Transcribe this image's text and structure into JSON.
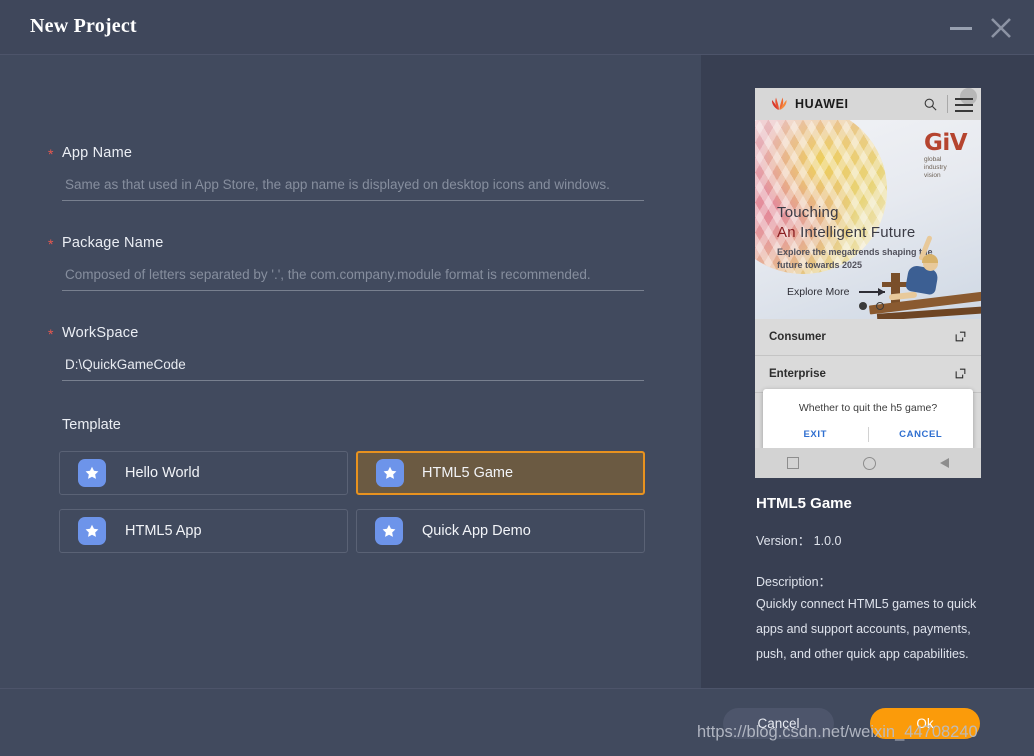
{
  "window": {
    "title": "New Project",
    "minimize_icon": "minimize-icon",
    "close_icon": "close-icon"
  },
  "form": {
    "fields": [
      {
        "label": "App Name",
        "required": "*",
        "value": "",
        "placeholder": "Same as that used in App Store, the app name is displayed on desktop icons and windows."
      },
      {
        "label": "Package Name",
        "required": "*",
        "value": "",
        "placeholder": "Composed of letters separated by '.', the com.company.module format is recommended."
      },
      {
        "label": "WorkSpace",
        "required": "*",
        "value": "D:\\QuickGameCode",
        "placeholder": ""
      }
    ],
    "template_label": "Template",
    "templates": [
      {
        "name": "Hello World",
        "icon": "star-icon",
        "selected": false
      },
      {
        "name": "HTML5 Game",
        "icon": "star-icon",
        "selected": true
      },
      {
        "name": "HTML5 App",
        "icon": "star-icon",
        "selected": false
      },
      {
        "name": "Quick App Demo",
        "icon": "star-icon",
        "selected": false
      }
    ]
  },
  "preview": {
    "phone": {
      "brand": "HUAWEI",
      "search_icon": "search-icon",
      "menu_icon": "hamburger-menu-icon",
      "banner": {
        "logo_mark": "GiV",
        "logo_sub": "global\nindustry\nvision",
        "line1": "Touching",
        "line2_accent": "An",
        "line2_rest": " Intelligent Future",
        "subtitle": "Explore the megatrends shaping the future towards 2025",
        "cta": "Explore More",
        "cta_icon": "arrow-right-icon",
        "carousel_dots": 2,
        "carousel_active": 1
      },
      "rows": [
        {
          "label": "Consumer",
          "icon": "external-link-icon"
        },
        {
          "label": "Enterprise",
          "icon": "external-link-icon"
        }
      ],
      "dialog": {
        "message": "Whether to quit the h5 game?",
        "confirm": "EXIT",
        "cancel": "CANCEL"
      },
      "navbar": [
        "square-icon",
        "circle-icon",
        "back-triangle-icon"
      ]
    },
    "detail": {
      "title": "HTML5 Game",
      "version": "Version： 1.0.0",
      "description_label": "Description：",
      "description": "Quickly connect HTML5 games to quick apps and support accounts, payments, push, and other quick app capabilities."
    }
  },
  "footer": {
    "cancel_label": "Cancel",
    "ok_label": "Ok"
  },
  "watermark": "https://blog.csdn.net/weixin_44708240",
  "colors": {
    "left_panel": "#414a5e",
    "right_panel": "#383f52",
    "accent_orange": "#fb9b0a",
    "selected_border": "#e8921f",
    "selected_fill": "#6b5a42",
    "icon_blue": "#6d94ea",
    "required_red": "#e8584f",
    "dialog_blue": "#2f6fd0"
  }
}
